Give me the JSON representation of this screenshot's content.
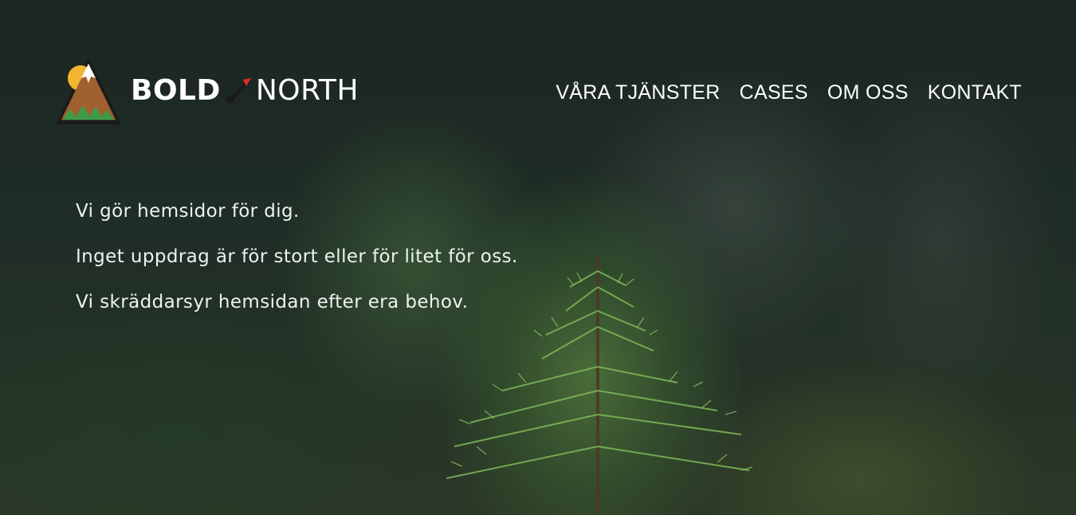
{
  "brand": {
    "name_bold": "BOLD",
    "name_light": "NORTH",
    "logo_icon": "mountain-badge-icon",
    "arrow_icon": "compass-arrow-icon",
    "colors": {
      "mountain_brown": "#a0602f",
      "sun_yellow": "#f2b632",
      "trees_green": "#3f9a4a",
      "arrow_red": "#e0302a",
      "outline": "#1a1a1a"
    }
  },
  "nav": {
    "items": [
      {
        "label": "VÅRA TJÄNSTER"
      },
      {
        "label": "CASES"
      },
      {
        "label": "OM OSS"
      },
      {
        "label": "KONTAKT"
      }
    ]
  },
  "hero": {
    "lines": [
      "Vi gör hemsidor för dig.",
      "Inget uppdrag är för stort eller för litet för oss.",
      "Vi skräddarsyr hemsidan efter era behov."
    ]
  }
}
